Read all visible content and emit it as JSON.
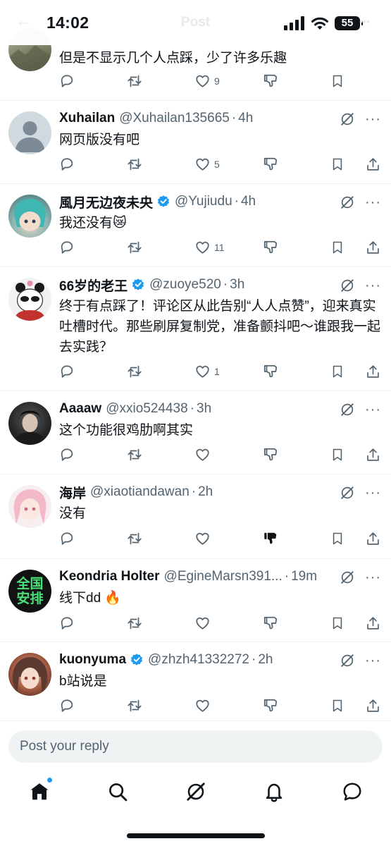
{
  "status_bar": {
    "time": "14:02",
    "battery": "55",
    "faded_title": "Post"
  },
  "colors": {
    "accent": "#1d9bf0",
    "text_primary": "#0f1419",
    "text_secondary": "#536471",
    "divider": "#eff3f4"
  },
  "replies": [
    {
      "name": "",
      "handle": "",
      "time": "",
      "text": "但是不显示几个人点踩，少了许多乐趣",
      "verified": false,
      "counts": {
        "replies": "",
        "reposts": "",
        "likes": "9"
      },
      "downvoted": false,
      "avatar_icon": "landscape-avatar"
    },
    {
      "name": "Xuhailan",
      "handle": "@Xuhailan135665",
      "time": "4h",
      "text": "网页版没有吧",
      "verified": false,
      "counts": {
        "replies": "",
        "reposts": "",
        "likes": "5"
      },
      "downvoted": false,
      "avatar_icon": "default-person-avatar"
    },
    {
      "name": "風月无边夜未央",
      "handle": "@Yujiudu",
      "time": "4h",
      "text": "我还没有😿",
      "verified": true,
      "counts": {
        "replies": "",
        "reposts": "",
        "likes": "11"
      },
      "downvoted": false,
      "avatar_icon": "anime-figure-avatar"
    },
    {
      "name": "66岁的老王",
      "handle": "@zuoye520",
      "time": "3h",
      "text": "终于有点踩了！评论区从此告别“人人点赞”，迎来真实吐槽时代。那些刷屏复制党，准备颤抖吧～谁跟我一起去实践？",
      "verified": true,
      "counts": {
        "replies": "",
        "reposts": "",
        "likes": "1"
      },
      "downvoted": false,
      "avatar_icon": "panda-avatar"
    },
    {
      "name": "Aaaaw",
      "handle": "@xxio524438",
      "time": "3h",
      "text": "这个功能很鸡肋啊其实",
      "verified": false,
      "counts": {
        "replies": "",
        "reposts": "",
        "likes": ""
      },
      "downvoted": false,
      "avatar_icon": "dark-portrait-avatar"
    },
    {
      "name": "海岸",
      "handle": "@xiaotiandawan",
      "time": "2h",
      "text": "没有",
      "verified": false,
      "counts": {
        "replies": "",
        "reposts": "",
        "likes": ""
      },
      "downvoted": true,
      "avatar_icon": "pink-anime-avatar"
    },
    {
      "name": "Keondria Holter",
      "handle": "@EgineMarsn391...",
      "time": "19m",
      "text": "线下dd 🔥",
      "verified": false,
      "counts": {
        "replies": "",
        "reposts": "",
        "likes": ""
      },
      "downvoted": false,
      "avatar_icon": "green-text-avatar",
      "avatar_text": "全国安排"
    },
    {
      "name": "kuonyuma",
      "handle": "@zhzh41332272",
      "time": "2h",
      "text": "b站说是",
      "verified": true,
      "counts": {
        "replies": "",
        "reposts": "",
        "likes": ""
      },
      "downvoted": false,
      "avatar_icon": "anime-girl-avatar"
    }
  ],
  "reply_input": {
    "placeholder": "Post your reply"
  },
  "bottom_nav": [
    "home-icon",
    "search-icon",
    "grok-icon",
    "notifications-icon",
    "messages-icon"
  ]
}
